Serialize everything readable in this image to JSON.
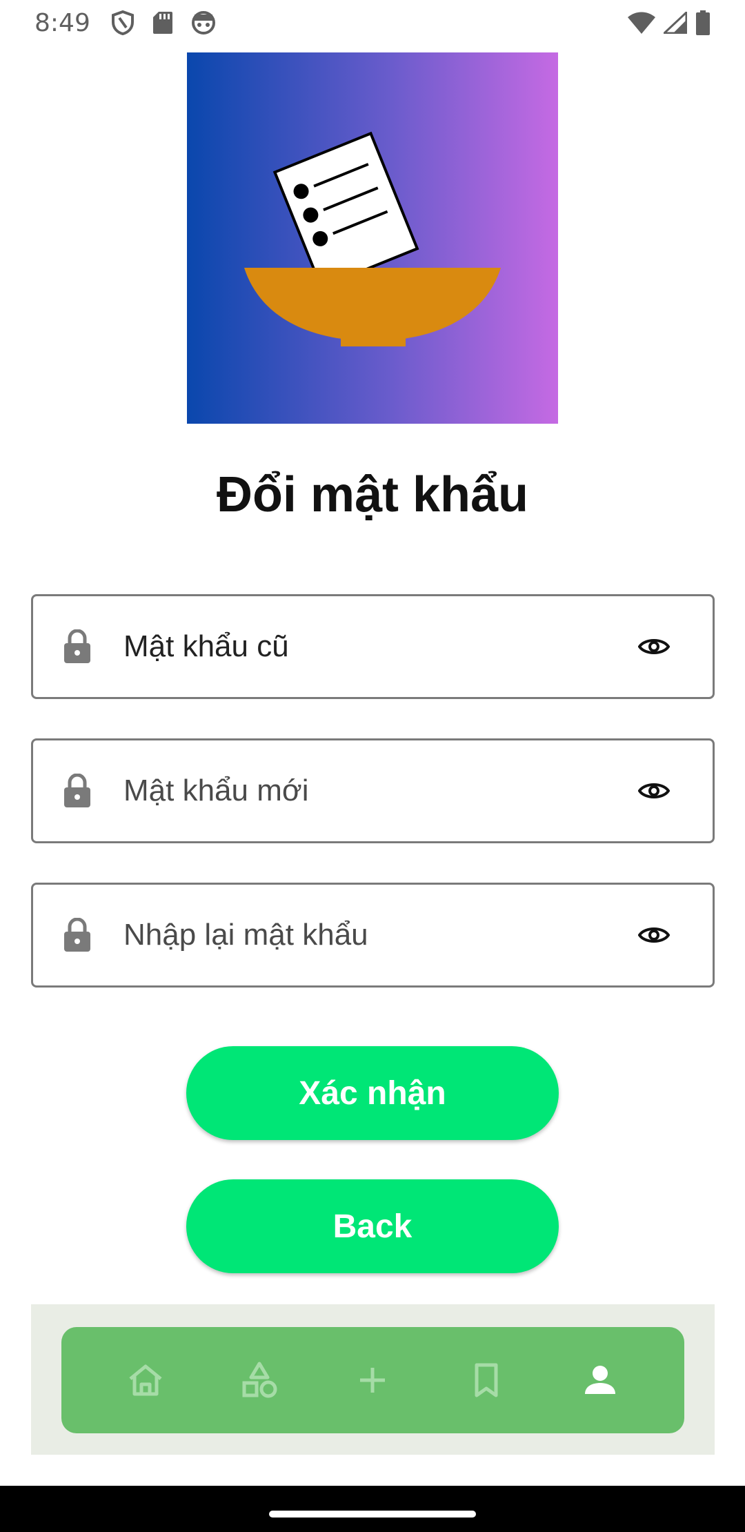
{
  "status_bar": {
    "time": "8:49",
    "left_icons": [
      "shield-icon",
      "sd-card-icon",
      "android-face-icon"
    ],
    "right_icons": [
      "wifi-icon",
      "signal-icon",
      "battery-icon"
    ]
  },
  "logo": {
    "icon": "ballot-box-icon",
    "colors": {
      "gradient_start": "#0a47ad",
      "gradient_end": "#c56ae3",
      "bowl": "#d98a10"
    }
  },
  "page": {
    "title": "Đổi mật khẩu"
  },
  "form": {
    "old_password": {
      "value": "Mật khẩu cũ",
      "icon": "lock-icon",
      "toggle_icon": "eye-icon"
    },
    "new_password": {
      "placeholder": "Mật khẩu mới",
      "icon": "lock-icon",
      "toggle_icon": "eye-icon"
    },
    "confirm_password": {
      "placeholder": "Nhập lại mật khẩu",
      "icon": "lock-icon",
      "toggle_icon": "eye-icon"
    }
  },
  "buttons": {
    "confirm_label": "Xác nhận",
    "back_label": "Back",
    "color": "#00e676"
  },
  "bottom_nav": {
    "background": "#69bf6b",
    "items": [
      {
        "icon": "home-icon",
        "active": false
      },
      {
        "icon": "shapes-icon",
        "active": false
      },
      {
        "icon": "plus-icon",
        "active": false
      },
      {
        "icon": "bookmark-icon",
        "active": false
      },
      {
        "icon": "person-icon",
        "active": true
      }
    ]
  }
}
